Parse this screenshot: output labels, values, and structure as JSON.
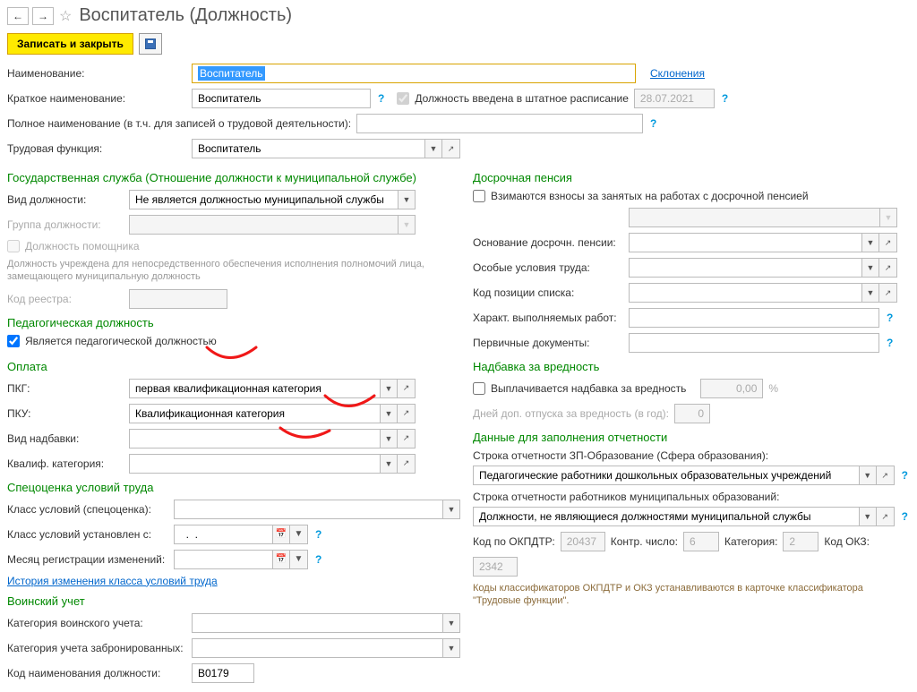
{
  "header": {
    "back": "←",
    "fwd": "→",
    "star": "☆",
    "title": "Воспитатель (Должность)"
  },
  "toolbar": {
    "save_close": "Записать и закрыть"
  },
  "main": {
    "name_lbl": "Наименование:",
    "name_val": "Воспитатель",
    "declension": "Склонения",
    "short_lbl": "Краткое наименование:",
    "short_val": "Воспитатель",
    "staff_chk": "Должность введена в штатное расписание",
    "staff_date": "28.07.2021",
    "full_lbl": "Полное наименование (в т.ч. для записей о трудовой деятельности):",
    "func_lbl": "Трудовая функция:",
    "func_val": "Воспитатель"
  },
  "gov": {
    "title": "Государственная служба (Отношение должности к муниципальной службе)",
    "type_lbl": "Вид должности:",
    "type_val": "Не является должностью муниципальной службы",
    "group_lbl": "Группа должности:",
    "assistant": "Должность помощника",
    "note": "Должность учреждена для непосредственного обеспечения исполнения полномочий лица, замещающего муниципальную должность",
    "registry_lbl": "Код реестра:"
  },
  "ped": {
    "title": "Педагогическая должность",
    "is_ped": "Является педагогической должностью"
  },
  "pay": {
    "title": "Оплата",
    "pkg_lbl": "ПКГ:",
    "pkg_val": "первая квалификационная категория",
    "pku_lbl": "ПКУ:",
    "pku_val": "Квалификационная категория",
    "allow_lbl": "Вид надбавки:",
    "qual_lbl": "Квалиф. категория:"
  },
  "special": {
    "title": "Спецоценка условий труда",
    "class_lbl": "Класс условий (спецоценка):",
    "from_lbl": "Класс условий установлен с:",
    "from_val": "  .  .    ",
    "month_lbl": "Месяц регистрации изменений:",
    "month_val": "          ",
    "history": "История изменения класса условий труда"
  },
  "military": {
    "title": "Воинский учет",
    "cat_lbl": "Категория воинского учета:",
    "reserved_lbl": "Категория учета забронированных:",
    "code_lbl": "Код наименования должности:",
    "code_val": "В0179"
  },
  "pension": {
    "title": "Досрочная пенсия",
    "contrib": "Взимаются взносы за занятых на работах с досрочной пенсией",
    "basis_lbl": "Основание досрочн. пенсии:",
    "cond_lbl": "Особые условия труда:",
    "poscode_lbl": "Код позиции списка:",
    "workchar_lbl": "Характ. выполняемых работ:",
    "prim_lbl": "Первичные документы:"
  },
  "harm": {
    "title": "Надбавка за вредность",
    "paid": "Выплачивается надбавка за вредность",
    "amount": "0,00",
    "pct": "%",
    "days_lbl": "Дней доп. отпуска за вредность (в год):",
    "days_val": "0"
  },
  "report": {
    "title": "Данные для заполнения отчетности",
    "edu_lbl": "Строка отчетности ЗП-Образование (Сфера образования):",
    "edu_val": "Педагогические работники дошкольных образовательных учреждений",
    "mun_lbl": "Строка отчетности работников муниципальных образований:",
    "mun_val": "Должности, не являющиеся должностями муниципальной службы",
    "okpdtr_lbl": "Код по ОКПДТР:",
    "okpdtr_val": "20437",
    "control_lbl": "Контр. число:",
    "control_val": "6",
    "cat_lbl": "Категория:",
    "cat_val": "2",
    "okz_lbl": "Код ОКЗ:",
    "okz_val": "2342",
    "note": "Коды классификаторов ОКПДТР и ОКЗ устанавливаются в карточке классификатора \"Трудовые функции\"."
  }
}
